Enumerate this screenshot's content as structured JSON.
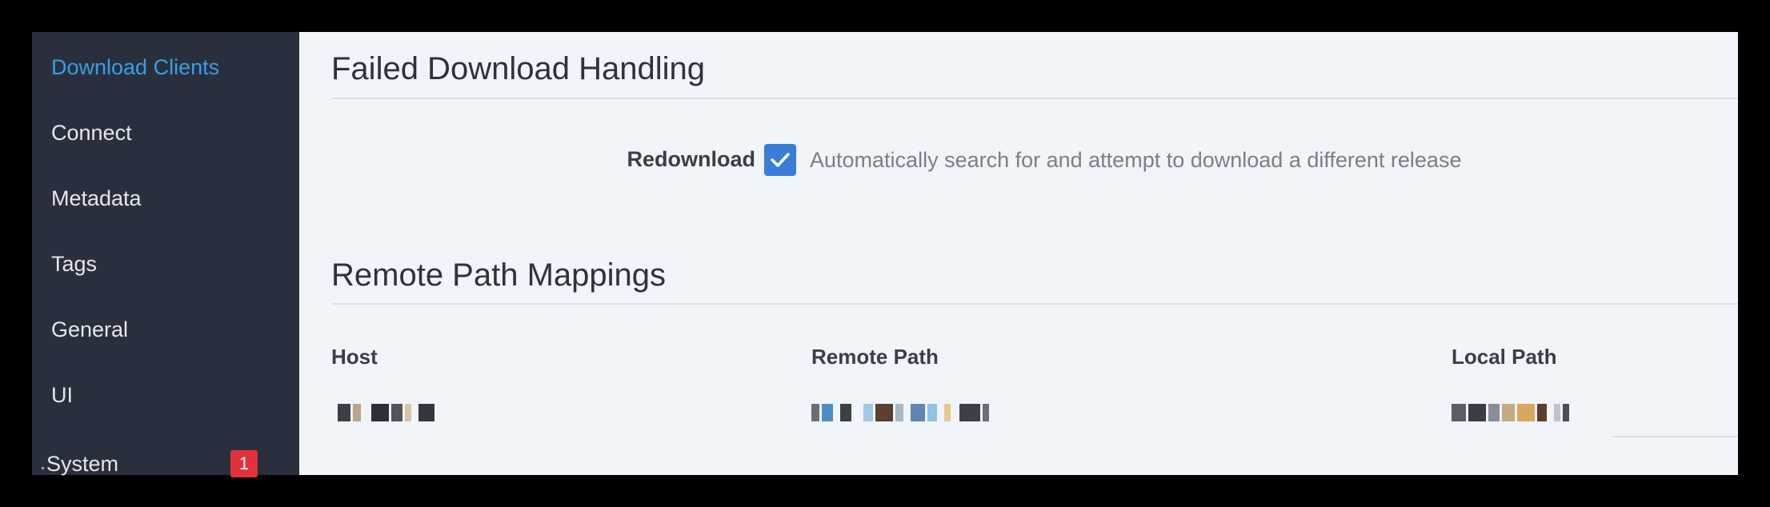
{
  "sidebar": {
    "items": [
      {
        "label": "Download Clients",
        "active": true
      },
      {
        "label": "Connect"
      },
      {
        "label": "Metadata"
      },
      {
        "label": "Tags"
      },
      {
        "label": "General"
      },
      {
        "label": "UI"
      },
      {
        "label": "System",
        "badge": "1"
      }
    ]
  },
  "failed_download": {
    "title": "Failed Download Handling",
    "redownload_label": "Redownload",
    "redownload_checked": true,
    "redownload_help": "Automatically search for and attempt to download a different release"
  },
  "remote_paths": {
    "title": "Remote Path Mappings",
    "columns": [
      "Host",
      "Remote Path",
      "Local Path"
    ]
  },
  "colors": {
    "sidebar_bg": "#2a2f3d",
    "accent": "#35a0e8",
    "checkbox": "#3a7cd7",
    "badge": "#e1323b",
    "content_bg": "#f1f4f8"
  }
}
